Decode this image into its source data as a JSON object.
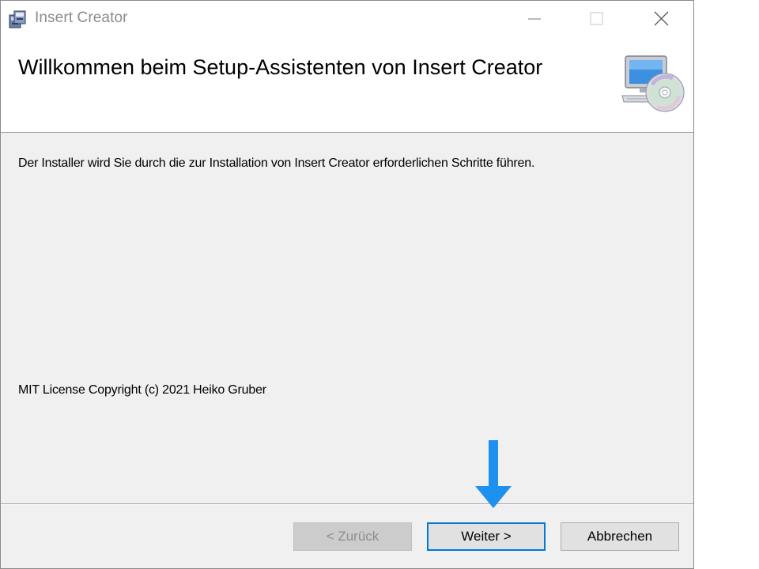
{
  "window": {
    "title": "Insert Creator",
    "controls": {
      "minimize_icon": "minimize-icon",
      "maximize_icon": "maximize-icon",
      "close_icon": "close-icon"
    }
  },
  "header": {
    "title": "Willkommen beim Setup-Assistenten von Insert Creator",
    "icon": "computer-cd-icon"
  },
  "content": {
    "intro": "Der Installer wird Sie durch die zur Installation von Insert Creator erforderlichen Schritte führen.",
    "license": "MIT License Copyright (c) 2021 Heiko Gruber"
  },
  "buttons": {
    "back_label": "< Zurück",
    "next_label": "Weiter >",
    "cancel_label": "Abbrechen"
  },
  "annotation": {
    "icon": "arrow-down-icon",
    "color": "#1e90f0"
  },
  "colors": {
    "accent": "#0078d7",
    "dialog_background": "#f0f0f0",
    "header_background": "#ffffff"
  }
}
